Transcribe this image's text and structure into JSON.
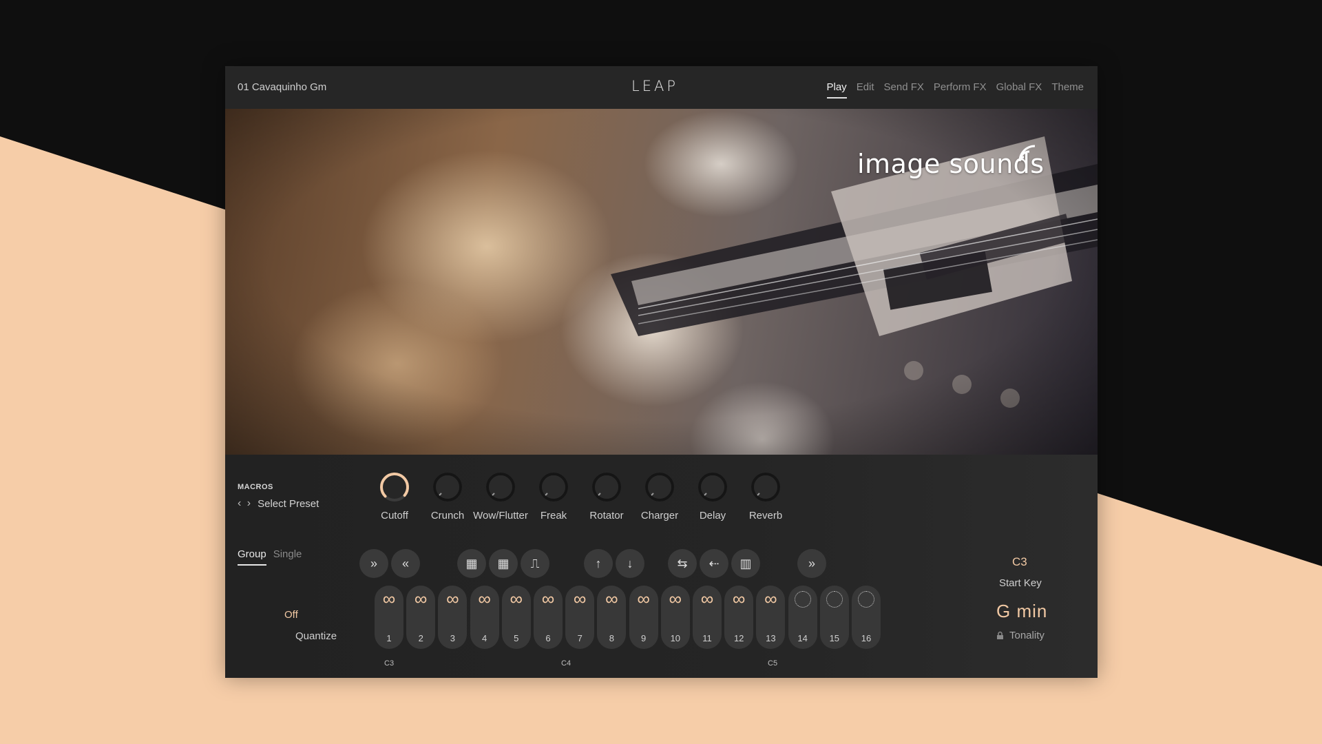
{
  "header": {
    "preset_name": "01 Cavaquinho Gm",
    "logo": "LEAP",
    "tabs": [
      "Play",
      "Edit",
      "Send FX",
      "Perform FX",
      "Global FX",
      "Theme"
    ],
    "active_tab": "Play"
  },
  "artwork": {
    "brand": "image sounds",
    "brand_icon": "wifi-waves-icon"
  },
  "macros": {
    "title": "MACROS",
    "select_preset": "Select Preset",
    "nav_icons": [
      "chevron-left-icon",
      "chevron-right-icon"
    ],
    "knobs": [
      {
        "label": "Cutoff",
        "value": 0.98,
        "active": true
      },
      {
        "label": "Crunch",
        "value": 0.0,
        "active": false
      },
      {
        "label": "Wow/Flutter",
        "value": 0.0,
        "active": false
      },
      {
        "label": "Freak",
        "value": 0.0,
        "active": false
      },
      {
        "label": "Rotator",
        "value": 0.0,
        "active": false
      },
      {
        "label": "Charger",
        "value": 0.0,
        "active": false
      },
      {
        "label": "Delay",
        "value": 0.0,
        "active": false
      },
      {
        "label": "Reverb",
        "value": 0.0,
        "active": false
      }
    ]
  },
  "mode_tabs": [
    "Group",
    "Single"
  ],
  "active_mode": "Group",
  "quantize": {
    "value": "Off",
    "label": "Quantize"
  },
  "controls": [
    {
      "icon": "fast-forward-icon",
      "glyph": "»"
    },
    {
      "icon": "rewind-icon",
      "glyph": "«"
    },
    {
      "icon": "shuffle-grid-icon",
      "glyph": "▦"
    },
    {
      "icon": "shuffle-grid-alt-icon",
      "glyph": "▦"
    },
    {
      "icon": "envelope-shape-icon",
      "glyph": "⎍"
    },
    {
      "icon": "arrow-up-icon",
      "glyph": "↑"
    },
    {
      "icon": "arrow-down-icon",
      "glyph": "↓"
    },
    {
      "icon": "swap-lanes-icon",
      "glyph": "⇆"
    },
    {
      "icon": "scatter-left-icon",
      "glyph": "⇠"
    },
    {
      "icon": "bars-icon",
      "glyph": "▥"
    },
    {
      "icon": "fast-forward-icon",
      "glyph": "»"
    }
  ],
  "pads": [
    {
      "num": "1",
      "state": "loop"
    },
    {
      "num": "2",
      "state": "loop"
    },
    {
      "num": "3",
      "state": "loop"
    },
    {
      "num": "4",
      "state": "loop"
    },
    {
      "num": "5",
      "state": "loop"
    },
    {
      "num": "6",
      "state": "loop"
    },
    {
      "num": "7",
      "state": "loop"
    },
    {
      "num": "8",
      "state": "loop"
    },
    {
      "num": "9",
      "state": "loop"
    },
    {
      "num": "10",
      "state": "loop"
    },
    {
      "num": "11",
      "state": "loop"
    },
    {
      "num": "12",
      "state": "loop"
    },
    {
      "num": "13",
      "state": "loop"
    },
    {
      "num": "14",
      "state": "oneshot"
    },
    {
      "num": "15",
      "state": "oneshot"
    },
    {
      "num": "16",
      "state": "oneshot"
    }
  ],
  "loop_glyph": "∞",
  "octave_labels": [
    "C3",
    "C4",
    "C5"
  ],
  "start_key": {
    "value": "C3",
    "label": "Start Key"
  },
  "tonality": {
    "value": "G  min",
    "label": "Tonality",
    "icon": "lock-icon"
  },
  "colors": {
    "accent": "#f2c9a4",
    "background_peach": "#f6cda8",
    "panel": "#242424"
  }
}
